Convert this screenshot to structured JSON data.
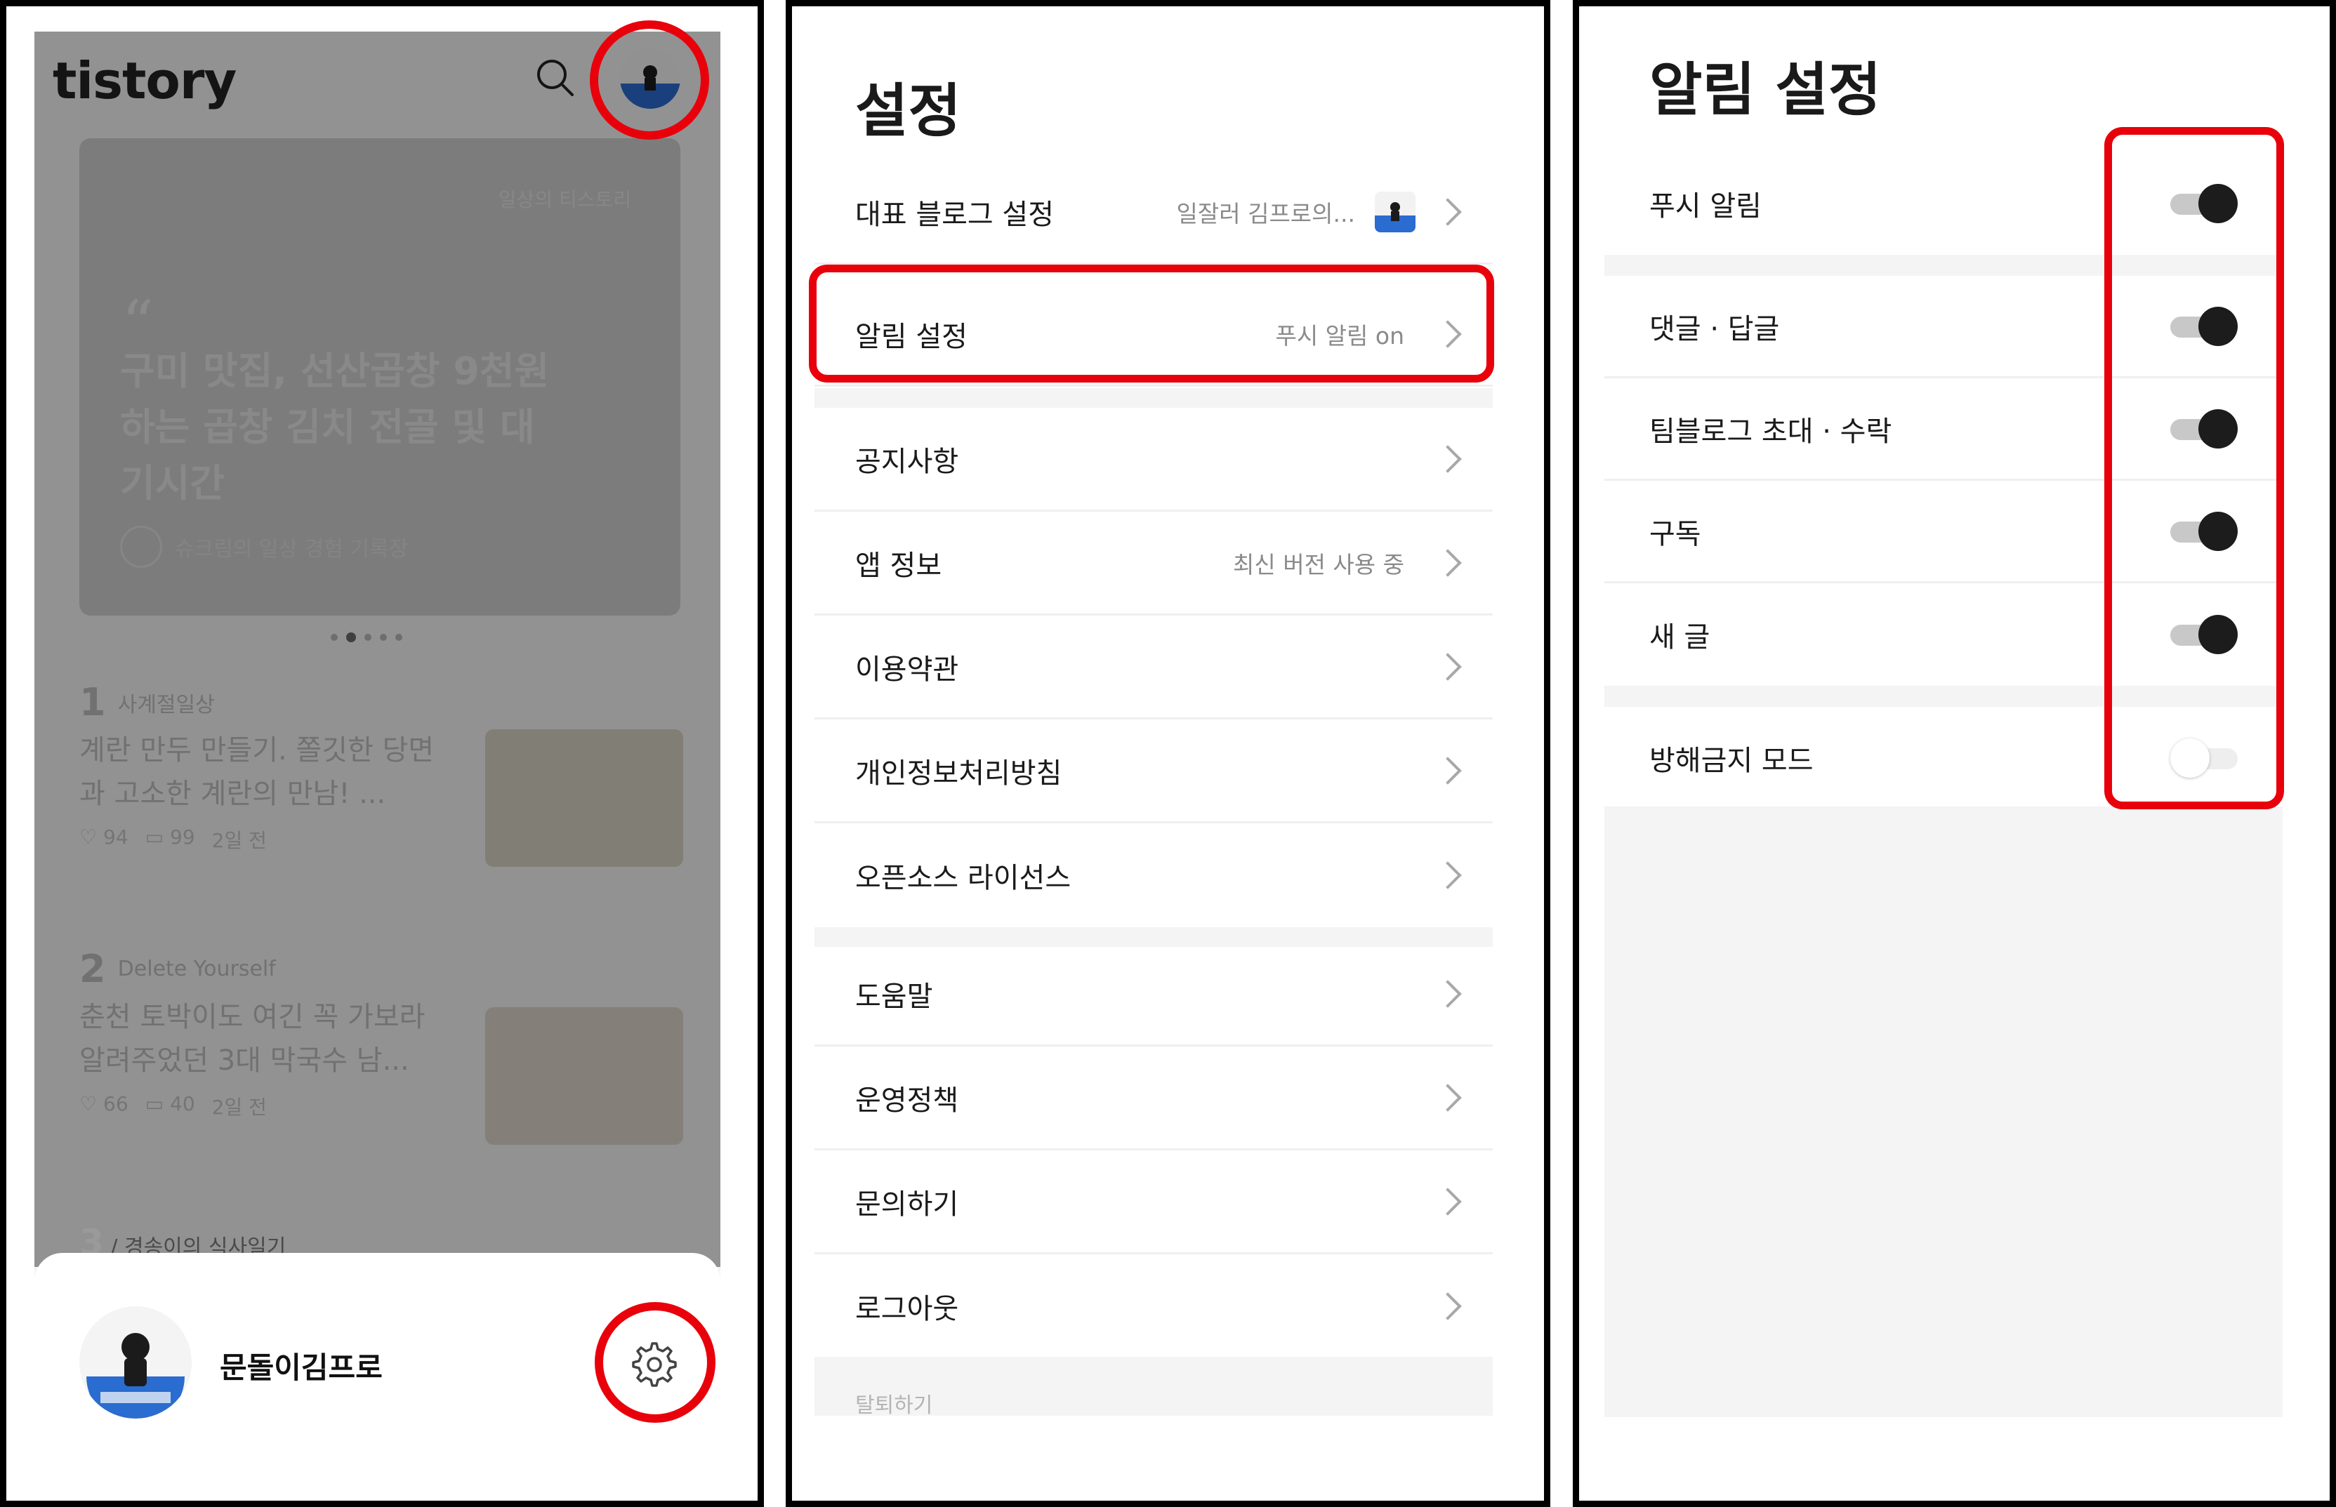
{
  "colors": {
    "highlight": "#e8000b",
    "toggle_on": "#1c1c1c",
    "toggle_track": "#c8c8c8",
    "section_gap": "#f4f4f4",
    "avatar_blue": "#2a6ccf"
  },
  "panel1": {
    "logo": "tistory",
    "card": {
      "category": "일상의 티스토리",
      "quote_mark": "“",
      "title": "구미 맛집, 선산곱창 9천원하는 곱창 김치 전골 및 대기시간",
      "author": "슈크림의 일상 경험 기록장"
    },
    "feed": [
      {
        "rank": "1",
        "blog": "사계절일상",
        "title": "계란 만두 만들기. 쫄깃한 당면과 고소한 계란의 만남! ...",
        "likes": "94",
        "comments": "99",
        "age": "2일 전"
      },
      {
        "rank": "2",
        "blog": "Delete Yourself",
        "title": "춘천 토박이도 여긴 꼭 가보라 알려주었던 3대 막국수 남...",
        "likes": "66",
        "comments": "40",
        "age": "2일 전"
      },
      {
        "rank": "3",
        "blog": "경송이의 식사일기"
      }
    ],
    "user_name": "문돌이김프로",
    "icons": {
      "search": "search-icon",
      "avatar": "avatar",
      "gear": "gear-icon"
    }
  },
  "panel2": {
    "title": "설정",
    "rows": [
      {
        "label": "대표 블로그 설정",
        "value": "일잘러 김프로의..."
      },
      {
        "label": "알림 설정",
        "value": "푸시 알림 on"
      },
      {
        "label": "공지사항",
        "value": ""
      },
      {
        "label": "앱 정보",
        "value": "최신 버전 사용 중"
      },
      {
        "label": "이용약관",
        "value": ""
      },
      {
        "label": "개인정보처리방침",
        "value": ""
      },
      {
        "label": "오픈소스 라이선스",
        "value": ""
      },
      {
        "label": "도움말",
        "value": ""
      },
      {
        "label": "운영정책",
        "value": ""
      },
      {
        "label": "문의하기",
        "value": ""
      },
      {
        "label": "로그아웃",
        "value": ""
      }
    ],
    "withdraw": "탈퇴하기"
  },
  "panel3": {
    "title": "알림 설정",
    "toggles": [
      {
        "label": "푸시 알림",
        "on": true
      },
      {
        "label": "댓글 · 답글",
        "on": true
      },
      {
        "label": "팀블로그 초대 · 수락",
        "on": true
      },
      {
        "label": "구독",
        "on": true
      },
      {
        "label": "새 글",
        "on": true
      },
      {
        "label": "방해금지 모드",
        "on": false
      }
    ]
  }
}
